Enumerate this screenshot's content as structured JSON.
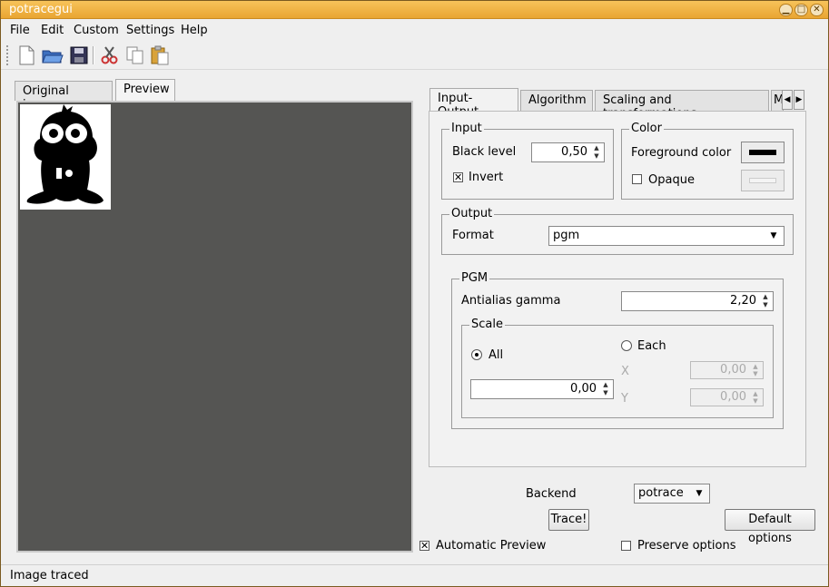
{
  "window": {
    "title": "potracegui"
  },
  "menu": {
    "file": "File",
    "edit": "Edit",
    "custom": "Custom",
    "settings": "Settings",
    "help": "Help"
  },
  "toolbar": {
    "icons": [
      "new-file-icon",
      "open-folder-icon",
      "save-icon",
      "cut-icon",
      "copy-icon",
      "paste-icon"
    ]
  },
  "left_tabs": {
    "original": "Original image",
    "preview": "Preview",
    "active": "Preview"
  },
  "right_tabs": {
    "input_output": "Input-Output",
    "algorithm": "Algorithm",
    "scaling": "Scaling and transformations",
    "more": "M",
    "active": "Input-Output"
  },
  "input_group": {
    "title": "Input",
    "black_level_label": "Black level",
    "black_level_value": "0,50",
    "invert_label": "Invert",
    "invert_checked": true
  },
  "color_group": {
    "title": "Color",
    "foreground_label": "Foreground color",
    "foreground_color": "#000000",
    "opaque_label": "Opaque",
    "opaque_checked": false
  },
  "output_group": {
    "title": "Output",
    "format_label": "Format",
    "format_value": "pgm"
  },
  "pgm_group": {
    "title": "PGM",
    "antialias_label": "Antialias gamma",
    "antialias_value": "2,20",
    "scale": {
      "title": "Scale",
      "all_label": "All",
      "each_label": "Each",
      "selected": "All",
      "all_value": "0,00",
      "x_label": "X",
      "x_value": "0,00",
      "y_label": "Y",
      "y_value": "0,00"
    }
  },
  "backend": {
    "label": "Backend",
    "value": "potrace"
  },
  "buttons": {
    "trace": "Trace!",
    "default_options": "Default options"
  },
  "checks": {
    "automatic_preview": "Automatic Preview",
    "automatic_preview_checked": true,
    "preserve_options": "Preserve options",
    "preserve_options_checked": false
  },
  "status": {
    "text": "Image traced"
  }
}
